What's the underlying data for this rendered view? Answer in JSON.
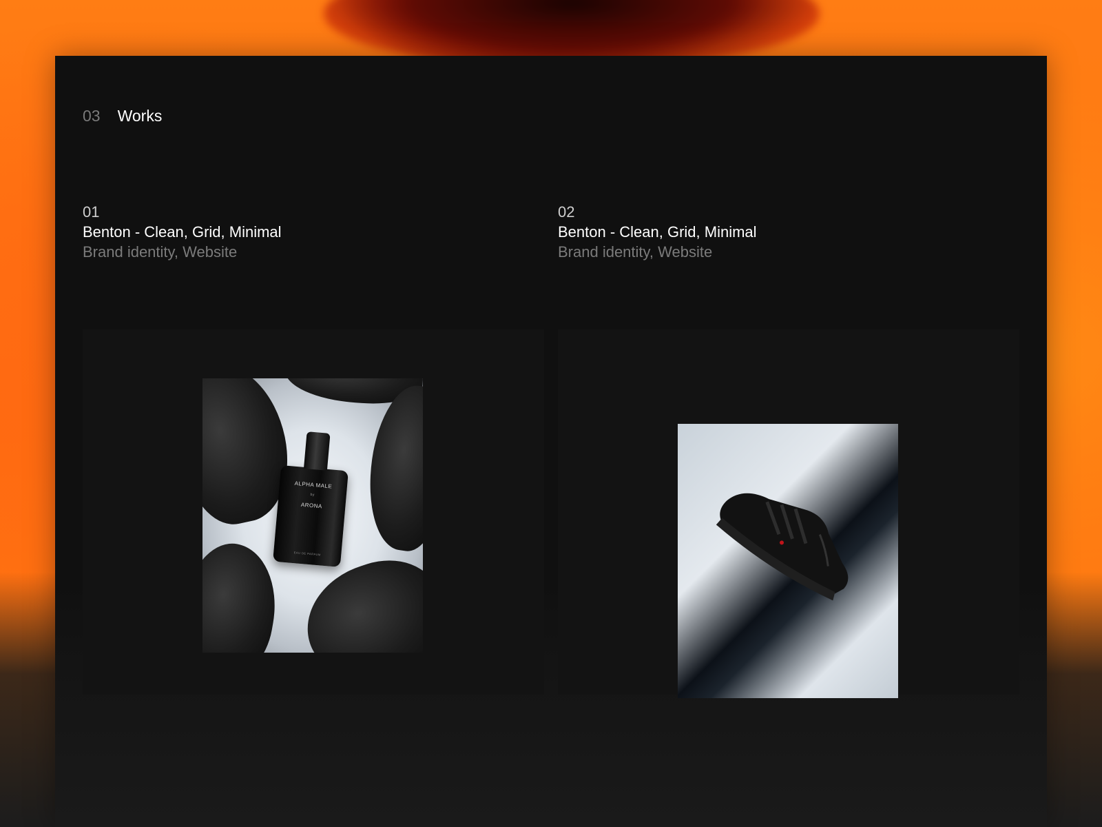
{
  "section": {
    "number": "03",
    "title": "Works"
  },
  "works": [
    {
      "number": "01",
      "title": "Benton - Clean, Grid, Minimal",
      "tags": "Brand identity, Website",
      "image_icon": "perfume-bottle-image",
      "bottle_label": {
        "line1": "ALPHA MALE",
        "line2": "by",
        "line3": "ARONA",
        "line4": "EAU DE PARFUM"
      }
    },
    {
      "number": "02",
      "title": "Benton - Clean, Grid, Minimal",
      "tags": "Brand identity, Website",
      "image_icon": "sneaker-image"
    }
  ],
  "colors": {
    "panel": "#101010",
    "backdrop": "#ff7a12",
    "text_primary": "#ffffff",
    "text_muted": "#7b7b7b"
  }
}
